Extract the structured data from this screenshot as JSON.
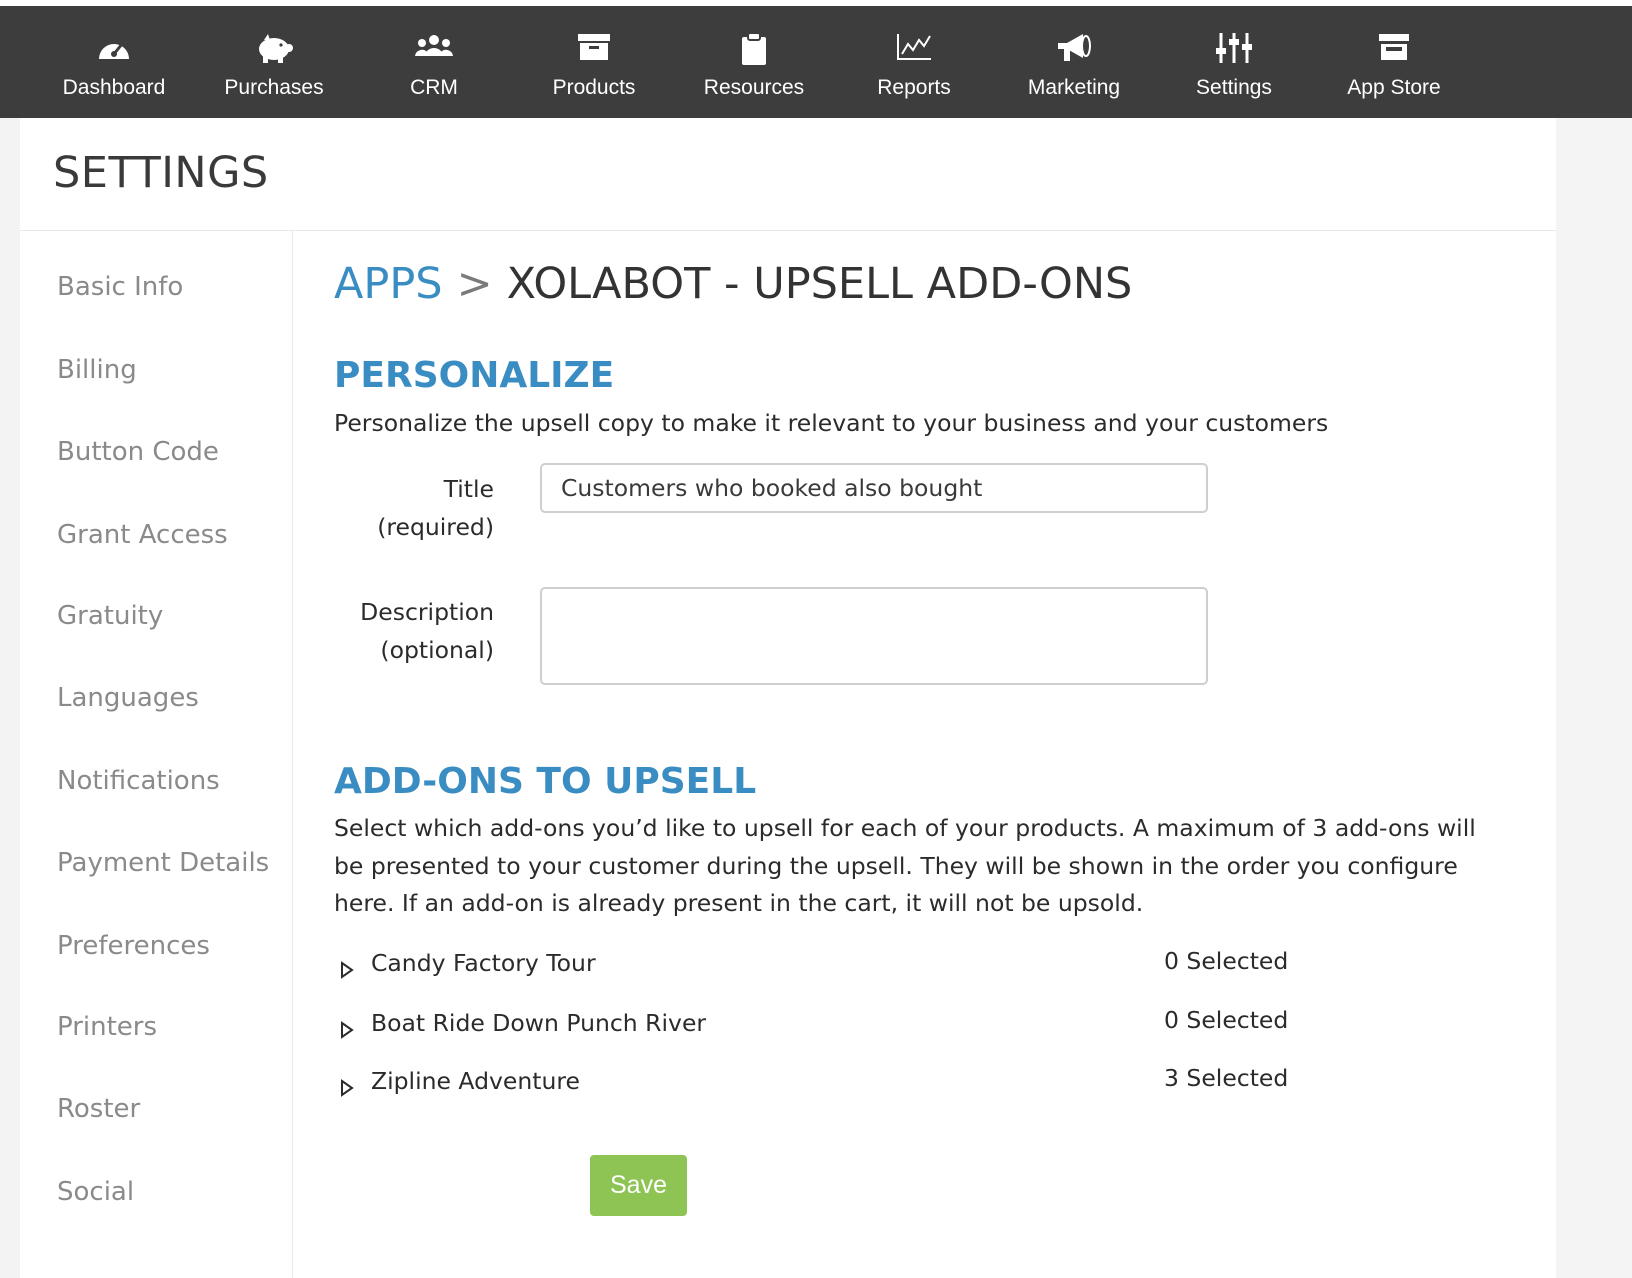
{
  "nav": {
    "items": [
      {
        "label": "Dashboard",
        "icon": "dashboard-gauge-icon"
      },
      {
        "label": "Purchases",
        "icon": "piggy-bank-icon"
      },
      {
        "label": "CRM",
        "icon": "people-group-icon"
      },
      {
        "label": "Products",
        "icon": "archive-box-icon"
      },
      {
        "label": "Resources",
        "icon": "clipboard-icon"
      },
      {
        "label": "Reports",
        "icon": "line-chart-icon"
      },
      {
        "label": "Marketing",
        "icon": "megaphone-icon"
      },
      {
        "label": "Settings",
        "icon": "sliders-icon"
      },
      {
        "label": "App Store",
        "icon": "storefront-icon"
      }
    ]
  },
  "page": {
    "title": "SETTINGS"
  },
  "sidebar": {
    "items": [
      {
        "label": "Basic Info"
      },
      {
        "label": "Billing"
      },
      {
        "label": "Button Code"
      },
      {
        "label": "Grant Access"
      },
      {
        "label": "Gratuity"
      },
      {
        "label": "Languages"
      },
      {
        "label": "Notifications"
      },
      {
        "label": "Payment Details"
      },
      {
        "label": "Preferences"
      },
      {
        "label": "Printers"
      },
      {
        "label": "Roster"
      },
      {
        "label": "Social"
      }
    ]
  },
  "breadcrumb": {
    "root": "APPS",
    "separator": ">",
    "current": "XOLABOT - UPSELL ADD-ONS"
  },
  "personalize": {
    "heading": "PERSONALIZE",
    "intro": "Personalize the upsell copy to make it relevant to your business and your customers",
    "title_label_1": "Title",
    "title_label_2": "(required)",
    "title_value": "Customers who booked also bought",
    "desc_label_1": "Description",
    "desc_label_2": "(optional)",
    "desc_value": ""
  },
  "addons": {
    "heading": "ADD-ONS TO UPSELL",
    "intro_1": "Select which add-ons you’d like to upsell for each of your products. A maximum of 3 add-ons will",
    "intro_2": "be presented to your customer during the upsell. They will be shown in the order you configure",
    "intro_3": "here. If an add-on is already present in the cart, it will not be upsold.",
    "items": [
      {
        "name": "Candy Factory Tour",
        "count": "0 Selected"
      },
      {
        "name": "Boat Ride Down Punch River",
        "count": "0 Selected"
      },
      {
        "name": "Zipline Adventure",
        "count": "3 Selected"
      }
    ]
  },
  "actions": {
    "save_label": "Save"
  },
  "colors": {
    "accent": "#3a8dc2",
    "nav_bg": "#3d3d3d",
    "save_bg": "#8dc453"
  }
}
